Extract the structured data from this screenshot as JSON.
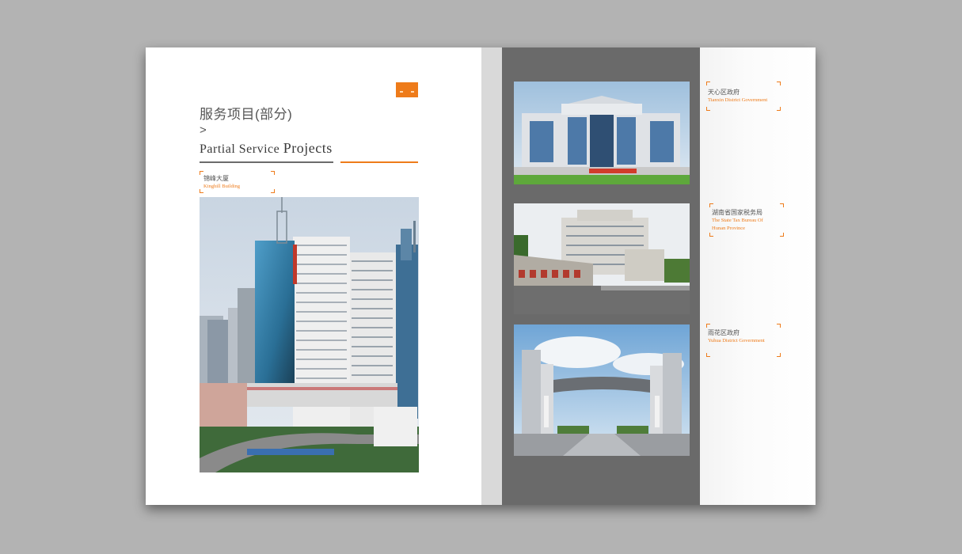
{
  "brochure": {
    "title_cn": "服务项目(部分)",
    "arrow": ">",
    "title_en_prefix": "Partial Service",
    "title_en_suffix": "Projects"
  },
  "projects": [
    {
      "name_cn": "锦峰大厦",
      "name_en": "Kinghill Building"
    },
    {
      "name_cn": "天心区政府",
      "name_en": "Tianxin District Government"
    },
    {
      "name_cn": "湖南省国家税务局",
      "name_en_line1": "The State Tax Bureau Of",
      "name_en_line2": "Hunan Province"
    },
    {
      "name_cn": "雨花区政府",
      "name_en": "Yuhua District Government"
    }
  ],
  "colors": {
    "accent": "#ee7b1a",
    "panel": "#6a6a6a",
    "background": "#b3b3b3"
  },
  "icons": {
    "logo": "book-logo-icon"
  }
}
